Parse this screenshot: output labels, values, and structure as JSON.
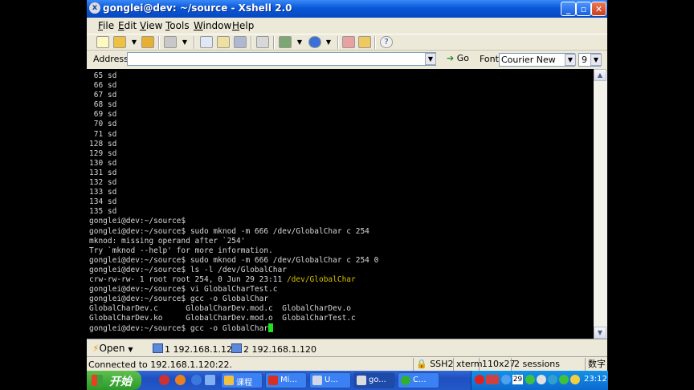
{
  "window": {
    "title": "gonglei@dev: ~/source - Xshell 2.0",
    "controls": {
      "minimize": "_",
      "maximize": "▫",
      "close": "✕"
    }
  },
  "menu": [
    {
      "label": "File",
      "key": "File"
    },
    {
      "label": "Edit",
      "key": "Edit"
    },
    {
      "label": "View",
      "key": "View"
    },
    {
      "label": "Tools",
      "key": "Tools"
    },
    {
      "label": "Window",
      "key": "Window"
    },
    {
      "label": "Help",
      "key": "Help"
    }
  ],
  "address_bar": {
    "label": "Address",
    "value": "",
    "go_label": "Go",
    "font_label": "Font",
    "font_value": "Courier New",
    "size_value": "9"
  },
  "terminal": {
    "lines": [
      " 65 sd",
      " 66 sd",
      " 67 sd",
      " 68 sd",
      " 69 sd",
      " 70 sd",
      " 71 sd",
      "128 sd",
      "129 sd",
      "130 sd",
      "131 sd",
      "132 sd",
      "133 sd",
      "134 sd",
      "135 sd",
      "gonglei@dev:~/source$",
      "gonglei@dev:~/source$ sudo mknod -m 666 /dev/GlobalChar c 254",
      "mknod: missing operand after `254'",
      "Try `mknod --help' for more information.",
      "gonglei@dev:~/source$ sudo mknod -m 666 /dev/GlobalChar c 254 0",
      "gonglei@dev:~/source$ ls -l /dev/GlobalChar",
      "crw-rw-rw- 1 root root 254, 0 Jun 29 23:11 /dev/GlobalChar",
      "gonglei@dev:~/source$ vi GlobalCharTest.c",
      "gonglei@dev:~/source$ gcc -o GlobalChar",
      "GlobalCharDev.c      GlobalCharDev.mod.c  GlobalCharDev.o",
      "GlobalCharDev.ko     GlobalCharDev.mod.o  GlobalCharTest.c",
      "gonglei@dev:~/source$ gcc -o GlobalChar"
    ]
  },
  "tabs_bar": {
    "open_label": "Open",
    "tabs": [
      {
        "number": "1",
        "label": "192.168.1.120"
      },
      {
        "number": "2",
        "label": "192.168.1.120"
      }
    ]
  },
  "status_bar": {
    "text": "Connected to 192.168.1.120:22.",
    "protocol": "SSH2",
    "term": "xterm",
    "size": "110x27",
    "sessions": "2 sessions",
    "ime": "数字"
  },
  "taskbar": {
    "start_label": "开始",
    "items": [
      {
        "label": "课程"
      },
      {
        "label": "Mi..."
      },
      {
        "label": "U..."
      },
      {
        "label": "go..."
      },
      {
        "label": "C..."
      }
    ],
    "tray_date": "29",
    "clock": "23:12"
  }
}
